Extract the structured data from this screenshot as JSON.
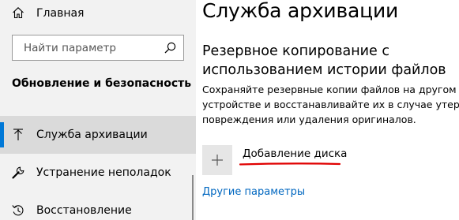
{
  "sidebar": {
    "home": {
      "label": "Главная",
      "icon": "home-icon"
    },
    "search": {
      "placeholder": "Найти параметр",
      "value": "",
      "icon": "search-icon"
    },
    "section_title": "Обновление и безопасность",
    "items": [
      {
        "label": "Служба архивации",
        "icon": "backup-icon",
        "selected": true
      },
      {
        "label": "Устранение неполадок",
        "icon": "wrench-icon",
        "selected": false
      },
      {
        "label": "Восстановление",
        "icon": "recovery-icon",
        "selected": false
      }
    ]
  },
  "main": {
    "title": "Служба архивации",
    "subtitle": "Резервное копирование с использованием истории файлов",
    "description": "Сохраняйте резервные копии файлов на другом устройстве и восстанавливайте их в случае утери, повреждения или удаления оригиналов.",
    "add_disk_label": "Добавление диска",
    "more_options_link": "Другие параметры"
  },
  "colors": {
    "accent": "#0078d7",
    "link": "#0067c0",
    "annotation": "#e00000",
    "sidebar_bg": "#f2f2f2",
    "selected_bg": "#dadada"
  }
}
